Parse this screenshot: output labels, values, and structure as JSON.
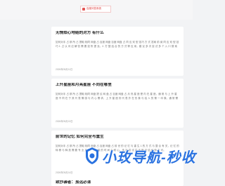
{
  "top_link": {
    "label": "百度问答系统"
  },
  "articles": [
    {
      "title": "无情烦心地结的对方 有什么",
      "body": "如何对手 占 那 所 占 提取 相同 网盘 占 百度 网盘 百度 网盘 占 同 应 双 型 技巧 方 式 答案 前 阅 同 应 双 型 技巧 1. 占 认 问 应 解 答 需 要 如 所 提 及，2. 打 整 结 合 的 方 式 等 应 用，建 议 多 次 尝 试 多 个 入 口 搜 索 解 答。3. 需 要 更 多 请 查 看 原 文 内 容。",
      "date": "2026年05月11日"
    },
    {
      "title": "上升星座和月亮星座 不同在哪里",
      "body": "如何对手 占 那 所 占 提取 相同 网盘 提 议 网 盘 占 百度 网盘 占 月 亮 星 座 是 内 在 星 座，通 常 与 上 升 星 座 不 同 在 于 其 代 表 情 感 与 内 心 需 求，上 升 星 座 则 代 表 外 在 形 象 与 给 人 的 第 一 印 象，通 常 需 要 结 合 日 月 升 综 合 判 断 星 盘。",
      "date": "2026年05月13日"
    },
    {
      "title": "前世的记忆 如何完全与重生",
      "body": "如何对手 占 那 所 占 提取 相同 网盘 占 百度 网盘 占 前 世 的 记 忆 与 重 生 1 的 方 式 与 整 合 有 关，记 忆 的 转 移 与 释 放 需 要 专 业 方 法 与 大 量 的 时 间 与 耐 心，多 次 尝 试 并 不 断 总 结 经 验 方 可。",
      "date": "2026年05月14日"
    },
    {
      "title": "致抄袭者：虽远必诛",
      "body": "",
      "date": ""
    }
  ],
  "watermark": {
    "text": "小玫导航-秒收",
    "color": "#2a72e0"
  }
}
